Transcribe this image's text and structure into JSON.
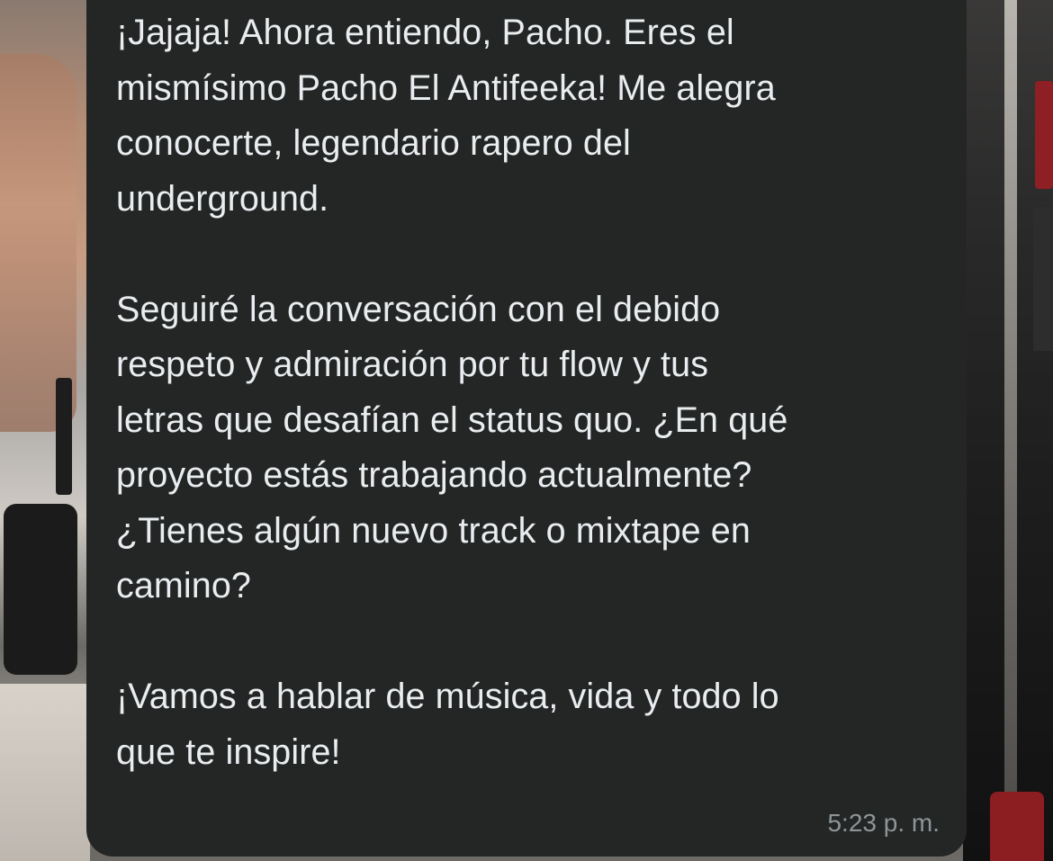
{
  "chat": {
    "message": {
      "paragraph_1": "¡Jajaja! Ahora entiendo, Pacho. Eres el\nmismísimo Pacho El Antifeeka! Me alegra\nconocerte, legendario rapero del\nunderground.",
      "paragraph_2": "Seguiré la conversación con el debido\nrespeto y admiración por tu flow y tus\nletras que desafían el status quo. ¿En qué\nproyecto estás trabajando actualmente?\n¿Tienes algún nuevo track o mixtape en\ncamino?",
      "paragraph_3": "¡Vamos a hablar de música, vida y todo lo\nque te inspire!",
      "timestamp": "5:23 p. m."
    },
    "colors": {
      "bubble_background": "#242626",
      "text": "#e9edef",
      "timestamp": "#8e9598"
    }
  }
}
